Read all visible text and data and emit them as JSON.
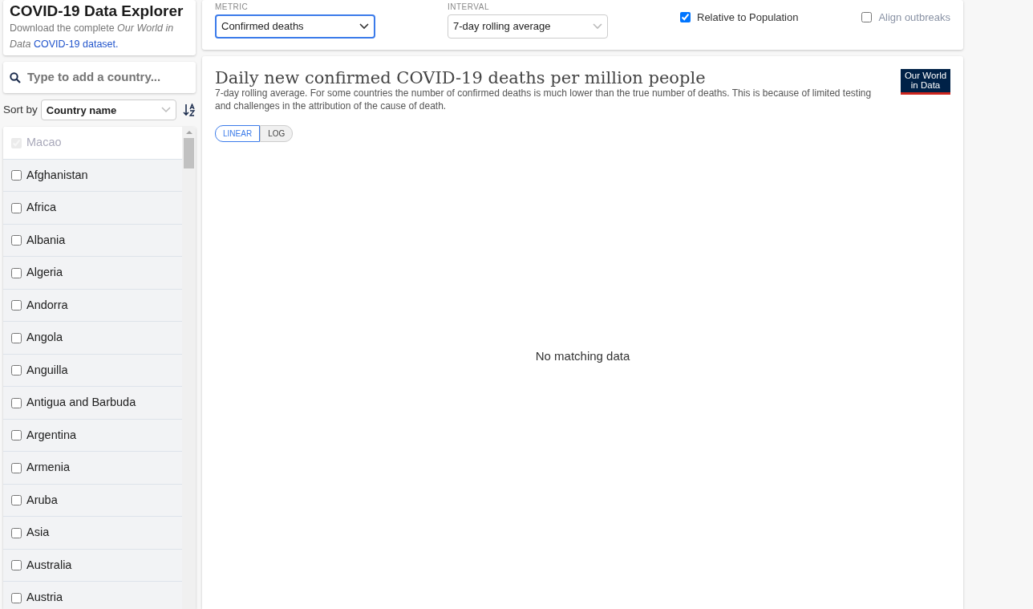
{
  "header": {
    "title": "COVID-19 Data Explorer",
    "description": "Download the complete *Our World in Data*",
    "link": "COVID-19 dataset."
  },
  "controls": {
    "metric": {
      "label": "METRIC",
      "value": "Confirmed deaths",
      "focused": true
    },
    "interval": {
      "label": "INTERVAL",
      "value": "7-day rolling average",
      "focused": false
    },
    "checkboxes": [
      {
        "label": "Relative to Population",
        "checked": true,
        "disabled": false
      },
      {
        "label": "Align outbreaks",
        "checked": false,
        "disabled": true
      }
    ]
  },
  "search": {
    "placeholder": "Type to add a country..."
  },
  "sort": {
    "label": "Sort by",
    "value": "Country name"
  },
  "countries": [
    {
      "name": "Macao",
      "checked": true,
      "disabled": true
    },
    {
      "name": "Afghanistan",
      "checked": false,
      "disabled": false
    },
    {
      "name": "Africa",
      "checked": false,
      "disabled": false
    },
    {
      "name": "Albania",
      "checked": false,
      "disabled": false
    },
    {
      "name": "Algeria",
      "checked": false,
      "disabled": false
    },
    {
      "name": "Andorra",
      "checked": false,
      "disabled": false
    },
    {
      "name": "Angola",
      "checked": false,
      "disabled": false
    },
    {
      "name": "Anguilla",
      "checked": false,
      "disabled": false
    },
    {
      "name": "Antigua and Barbuda",
      "checked": false,
      "disabled": false
    },
    {
      "name": "Argentina",
      "checked": false,
      "disabled": false
    },
    {
      "name": "Armenia",
      "checked": false,
      "disabled": false
    },
    {
      "name": "Aruba",
      "checked": false,
      "disabled": false
    },
    {
      "name": "Asia",
      "checked": false,
      "disabled": false
    },
    {
      "name": "Australia",
      "checked": false,
      "disabled": false
    },
    {
      "name": "Austria",
      "checked": false,
      "disabled": false
    }
  ],
  "chart": {
    "title": "Daily new confirmed COVID-19 deaths per million people",
    "subtitle": "7-day rolling average. For some countries the number of confirmed deaths is much lower than the true number of deaths. This is because of limited testing and challenges in the attribution of the cause of death.",
    "logo": [
      "Our World",
      "in Data"
    ],
    "scales": [
      {
        "label": "LINEAR",
        "selected": true
      },
      {
        "label": "LOG",
        "selected": false
      }
    ],
    "empty_message": "No matching data"
  }
}
